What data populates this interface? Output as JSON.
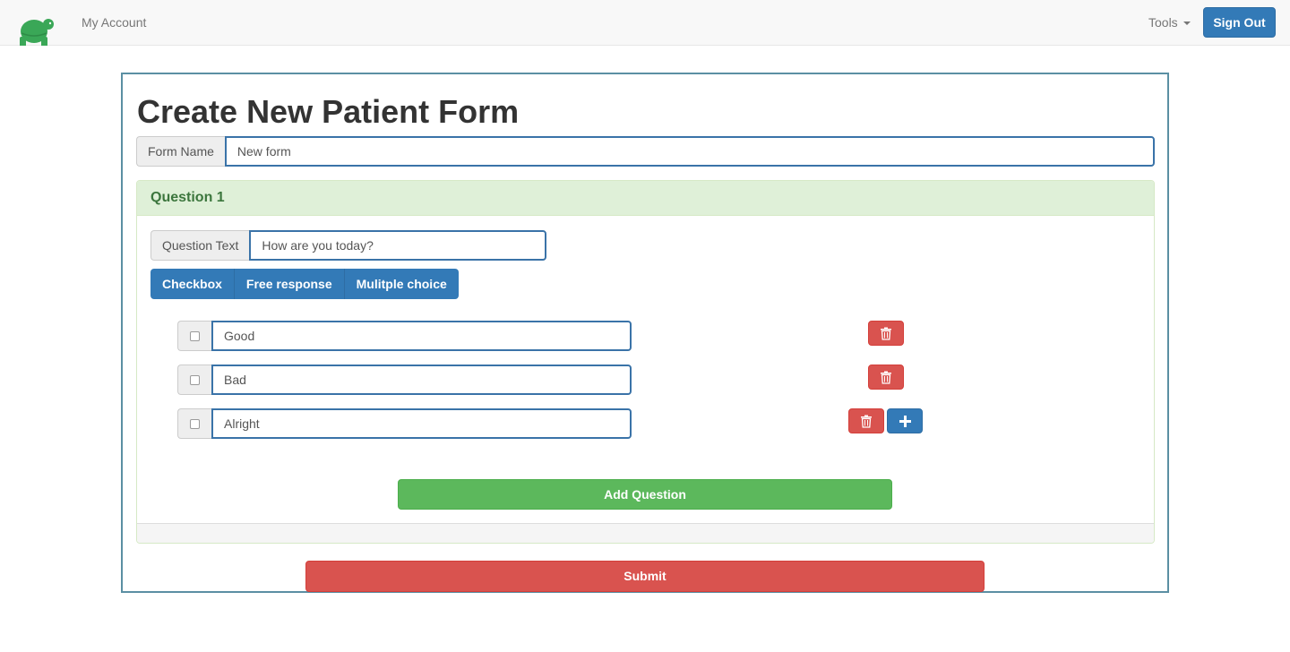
{
  "navbar": {
    "account_label": "My Account",
    "tools_label": "Tools",
    "signout_label": "Sign Out",
    "brand_color": "#3aa757"
  },
  "page": {
    "title": "Create New Patient Form"
  },
  "form": {
    "name_label": "Form Name",
    "name_value": "New form",
    "submit_label": "Submit"
  },
  "question": {
    "heading": "Question 1",
    "text_label": "Question Text",
    "text_value": "How are you today?",
    "types": [
      "Checkbox",
      "Free response",
      "Mulitple choice"
    ],
    "choices": [
      {
        "value": "Good",
        "checked": false
      },
      {
        "value": "Bad",
        "checked": false
      },
      {
        "value": "Alright",
        "checked": false
      }
    ],
    "add_question_label": "Add Question",
    "delete_icon": "trash-icon",
    "add_icon": "plus-icon"
  }
}
